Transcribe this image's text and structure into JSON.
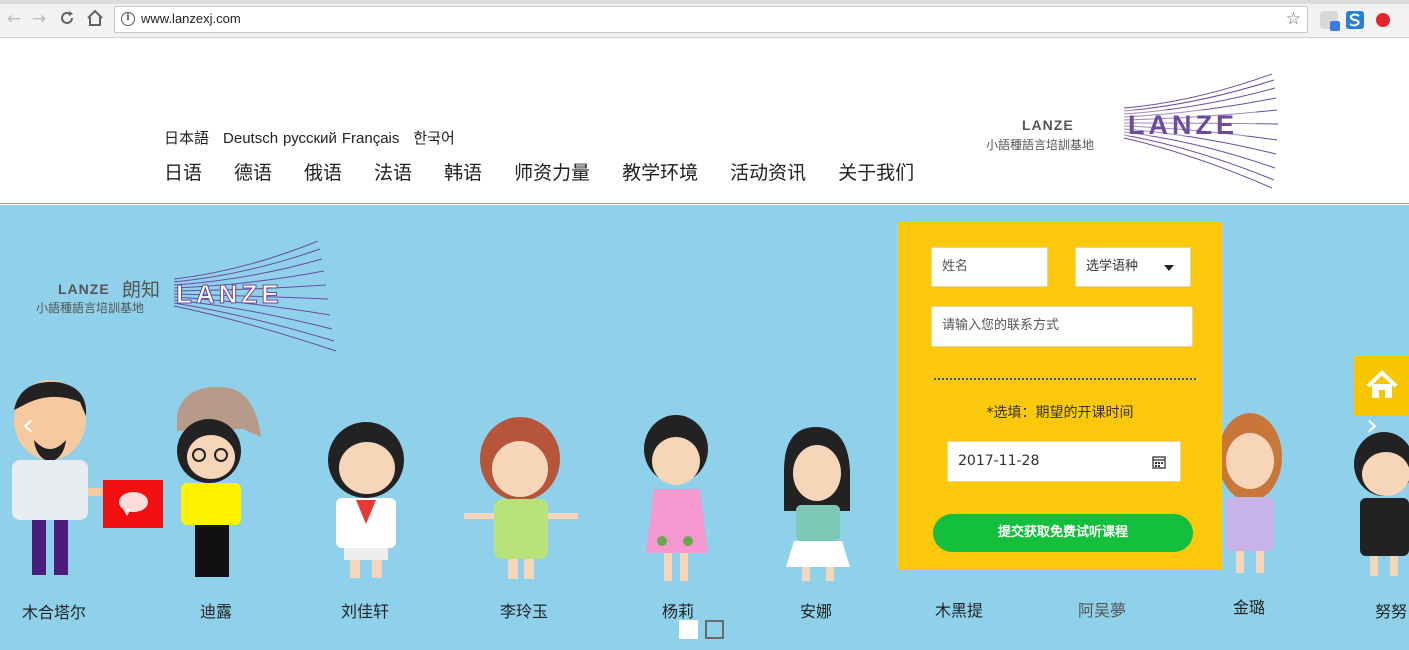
{
  "browser": {
    "url": "www.lanzexj.com",
    "back_glyph": "←",
    "forward_glyph": "→",
    "reload_glyph": "C",
    "home_glyph": "⌂",
    "star_glyph": "☆",
    "info_glyph": "i"
  },
  "header": {
    "languages": [
      "日本語",
      "Deutsch",
      "русский",
      "Français",
      "한국어"
    ],
    "nav": [
      "日语",
      "德语",
      "俄语",
      "法语",
      "韩语",
      "师资力量",
      "教学环境",
      "活动资讯",
      "关于我们"
    ],
    "logo": {
      "brand_small": "LANZE",
      "brand_big": "LANZE",
      "tagline": "小語種語言培訓基地"
    }
  },
  "banner": {
    "logo": {
      "brand_small": "LANZE",
      "brand_cn": "朗知",
      "brand_big": "LANZE",
      "tagline": "小語種語言培訓基地"
    },
    "teachers": [
      "木合塔尔",
      "迪露",
      "刘佳轩",
      "李玲玉",
      "杨莉",
      "安娜",
      "木黑提",
      "阿吴夢",
      "金璐",
      "努努"
    ],
    "prev_glyph": "‹",
    "next_glyph": "›"
  },
  "form": {
    "name_placeholder": "姓名",
    "language_select": "选学语种",
    "contact_placeholder": "请输入您的联系方式",
    "time_label": "*选填：期望的开课时间",
    "date_value": "2017-11-28",
    "submit_label": "提交获取免费试听课程"
  },
  "colors": {
    "banner_bg": "#8fd1eb",
    "form_bg": "#fbc80b",
    "submit_bg": "#13bf3c",
    "logo_purple": "#6b4aa0",
    "chat_red": "#f20f0f"
  }
}
